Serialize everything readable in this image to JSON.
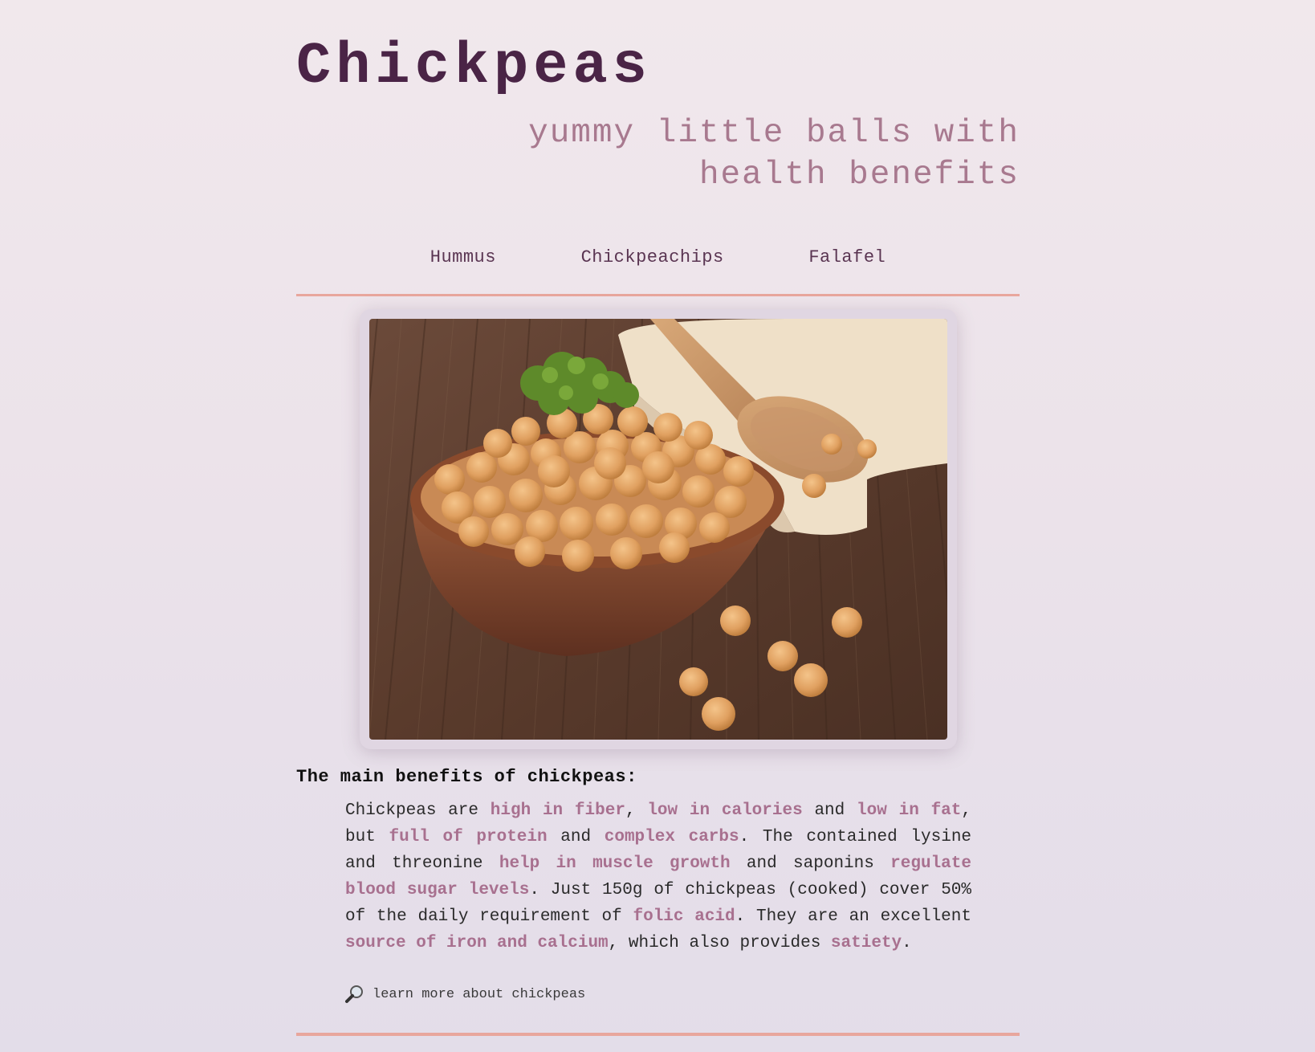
{
  "header": {
    "title": "Chickpeas",
    "subtitle": "yummy little balls with health benefits"
  },
  "nav": {
    "items": [
      "Hummus",
      "Chickpeachips",
      "Falafel"
    ]
  },
  "photo": {
    "icon": "chickpea-bowl-image"
  },
  "content": {
    "heading": "The main benefits of chickpeas:",
    "paragraph": {
      "t1": "Chickpeas are ",
      "h1": "high in fiber",
      "t2": ", ",
      "h2": "low in calories",
      "t3": " and ",
      "h3": "low in fat",
      "t4": ", but ",
      "h4": "full of protein",
      "t5": " and ",
      "h5": "complex carbs",
      "t6": ". The contained lysine and threonine ",
      "h6": "help in muscle growth",
      "t7": " and saponins ",
      "h7": "regulate blood sugar levels",
      "t8": ". Just 150g of chickpeas (cooked) cover 50% of the daily requirement of ",
      "h8": "folic acid",
      "t9": ". They are an excellent ",
      "h9": "source of iron and calcium",
      "t10": ", which also provides ",
      "h10": "satiety",
      "t11": "."
    },
    "learn_more": "learn more about chickpeas"
  },
  "colors": {
    "title": "#4a2446",
    "subtitle": "#a8798f",
    "highlight": "#a8708f",
    "rule": "#e8a69d"
  }
}
